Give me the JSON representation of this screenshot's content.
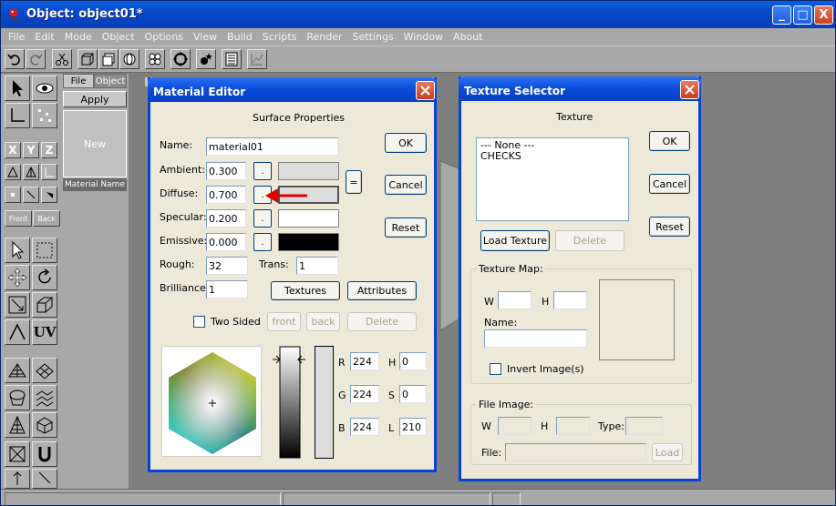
{
  "window": {
    "title": "Object: object01*",
    "minimize_label": "_",
    "maximize_label": "□",
    "close_label": "X"
  },
  "menu": [
    "File",
    "Edit",
    "Mode",
    "Object",
    "Options",
    "View",
    "Build",
    "Scripts",
    "Render",
    "Settings",
    "Window",
    "About"
  ],
  "left_tools": {
    "axis_x": "X",
    "axis_y": "Y",
    "axis_z": "Z",
    "front_label": "Front",
    "back_label": "Back",
    "uv_label": "UV"
  },
  "material_panel": {
    "tab_file": "File",
    "tab_object": "Object",
    "apply_label": "Apply",
    "new_label": "New",
    "material_name_label": "Material Name"
  },
  "material_editor": {
    "title": "Material Editor",
    "section_title": "Surface Properties",
    "name_label": "Name:",
    "name_value": "material01",
    "ambient_label": "Ambient:",
    "ambient_value": "0.300",
    "diffuse_label": "Diffuse:",
    "diffuse_value": "0.700",
    "specular_label": "Specular:",
    "specular_value": "0.200",
    "emissive_label": "Emissive:",
    "emissive_value": "0.000",
    "rough_label": "Rough:",
    "rough_value": "32",
    "trans_label": "Trans:",
    "trans_value": "1",
    "brilliance_label": "Brilliance:",
    "brilliance_value": "1",
    "small_button_label": ".",
    "equals_label": "=",
    "ok_label": "OK",
    "cancel_label": "Cancel",
    "reset_label": "Reset",
    "textures_label": "Textures",
    "attributes_label": "Attributes",
    "two_sided_label": "Two Sided",
    "front_label": "front",
    "back_label": "back",
    "delete_label": "Delete",
    "r_label": "R",
    "r_value": "224",
    "g_label": "G",
    "g_value": "224",
    "b_label": "B",
    "b_value": "224",
    "h_label": "H",
    "h_value": "0",
    "s_label": "S",
    "s_value": "0",
    "l_label": "L",
    "l_value": "210",
    "ambient_color": "#dcdcdc",
    "diffuse_color": "#dcdcdc",
    "specular_color": "#ffffff",
    "emissive_color": "#000000"
  },
  "texture_selector": {
    "title": "Texture Selector",
    "texture_label": "Texture",
    "list_items": [
      "--- None ---",
      "CHECKS"
    ],
    "ok_label": "OK",
    "cancel_label": "Cancel",
    "reset_label": "Reset",
    "load_texture_label": "Load Texture",
    "delete_label": "Delete",
    "texture_map_label": "Texture Map:",
    "w_label": "W",
    "h_label": "H",
    "w_value": "",
    "h_value": "",
    "name_label": "Name:",
    "name_value": "",
    "invert_label": "Invert Image(s)",
    "file_image_label": "File Image:",
    "fw_label": "W",
    "fh_label": "H",
    "type_label": "Type:",
    "file_label": "File:",
    "load_label": "Load"
  },
  "accent_color": "#0842d8",
  "arrow_color": "#e00000"
}
